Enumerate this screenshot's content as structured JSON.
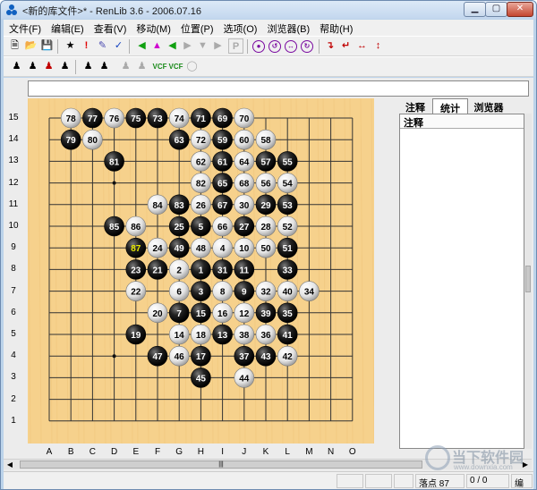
{
  "window": {
    "title": "<新的库文件>* - RenLib 3.6 - 2006.07.16",
    "minimize_label": "▁",
    "maximize_label": "▢",
    "close_label": "✕"
  },
  "menu": [
    "文件(F)",
    "编辑(E)",
    "查看(V)",
    "移动(M)",
    "位置(P)",
    "选项(O)",
    "浏览器(B)",
    "帮助(H)"
  ],
  "toolbar1": {
    "p_label": "P"
  },
  "toolbar2": {
    "vcf1_label": "VCF",
    "vcf2_label": "VCF"
  },
  "board": {
    "columns": [
      "A",
      "B",
      "C",
      "D",
      "E",
      "F",
      "G",
      "H",
      "I",
      "J",
      "K",
      "L",
      "M",
      "N",
      "O"
    ],
    "rows": [
      "15",
      "14",
      "13",
      "12",
      "11",
      "10",
      "9",
      "8",
      "7",
      "6",
      "5",
      "4",
      "3",
      "2",
      "1"
    ],
    "stones": [
      {
        "n": "1",
        "c": "H",
        "r": 8,
        "color": "black"
      },
      {
        "n": "2",
        "c": "G",
        "r": 8,
        "color": "white"
      },
      {
        "n": "3",
        "c": "H",
        "r": 7,
        "color": "black"
      },
      {
        "n": "4",
        "c": "I",
        "r": 9,
        "color": "white"
      },
      {
        "n": "5",
        "c": "H",
        "r": 10,
        "color": "black"
      },
      {
        "n": "6",
        "c": "G",
        "r": 7,
        "color": "white"
      },
      {
        "n": "7",
        "c": "G",
        "r": 6,
        "color": "black"
      },
      {
        "n": "8",
        "c": "I",
        "r": 7,
        "color": "white"
      },
      {
        "n": "9",
        "c": "J",
        "r": 7,
        "color": "black"
      },
      {
        "n": "10",
        "c": "J",
        "r": 9,
        "color": "white"
      },
      {
        "n": "11",
        "c": "J",
        "r": 8,
        "color": "black"
      },
      {
        "n": "12",
        "c": "J",
        "r": 6,
        "color": "white"
      },
      {
        "n": "13",
        "c": "I",
        "r": 5,
        "color": "black"
      },
      {
        "n": "14",
        "c": "G",
        "r": 5,
        "color": "white"
      },
      {
        "n": "15",
        "c": "H",
        "r": 6,
        "color": "black"
      },
      {
        "n": "16",
        "c": "I",
        "r": 6,
        "color": "white"
      },
      {
        "n": "17",
        "c": "H",
        "r": 4,
        "color": "black"
      },
      {
        "n": "18",
        "c": "H",
        "r": 5,
        "color": "white"
      },
      {
        "n": "19",
        "c": "E",
        "r": 5,
        "color": "black"
      },
      {
        "n": "20",
        "c": "F",
        "r": 6,
        "color": "white"
      },
      {
        "n": "21",
        "c": "F",
        "r": 8,
        "color": "black"
      },
      {
        "n": "22",
        "c": "E",
        "r": 7,
        "color": "white"
      },
      {
        "n": "23",
        "c": "E",
        "r": 8,
        "color": "black"
      },
      {
        "n": "24",
        "c": "F",
        "r": 9,
        "color": "white"
      },
      {
        "n": "25",
        "c": "G",
        "r": 10,
        "color": "black"
      },
      {
        "n": "26",
        "c": "H",
        "r": 11,
        "color": "white"
      },
      {
        "n": "27",
        "c": "J",
        "r": 10,
        "color": "black"
      },
      {
        "n": "28",
        "c": "K",
        "r": 10,
        "color": "white"
      },
      {
        "n": "29",
        "c": "K",
        "r": 11,
        "color": "black"
      },
      {
        "n": "30",
        "c": "J",
        "r": 11,
        "color": "white"
      },
      {
        "n": "31",
        "c": "I",
        "r": 8,
        "color": "black"
      },
      {
        "n": "32",
        "c": "K",
        "r": 7,
        "color": "white"
      },
      {
        "n": "33",
        "c": "L",
        "r": 8,
        "color": "black"
      },
      {
        "n": "34",
        "c": "M",
        "r": 7,
        "color": "white"
      },
      {
        "n": "35",
        "c": "L",
        "r": 6,
        "color": "black"
      },
      {
        "n": "36",
        "c": "K",
        "r": 5,
        "color": "white"
      },
      {
        "n": "37",
        "c": "J",
        "r": 4,
        "color": "black"
      },
      {
        "n": "38",
        "c": "J",
        "r": 5,
        "color": "white"
      },
      {
        "n": "39",
        "c": "K",
        "r": 6,
        "color": "black"
      },
      {
        "n": "40",
        "c": "L",
        "r": 7,
        "color": "white"
      },
      {
        "n": "41",
        "c": "L",
        "r": 5,
        "color": "black"
      },
      {
        "n": "42",
        "c": "L",
        "r": 4,
        "color": "white"
      },
      {
        "n": "43",
        "c": "K",
        "r": 4,
        "color": "black"
      },
      {
        "n": "44",
        "c": "J",
        "r": 3,
        "color": "white"
      },
      {
        "n": "45",
        "c": "H",
        "r": 3,
        "color": "black"
      },
      {
        "n": "46",
        "c": "G",
        "r": 4,
        "color": "white"
      },
      {
        "n": "47",
        "c": "F",
        "r": 4,
        "color": "black"
      },
      {
        "n": "48",
        "c": "H",
        "r": 9,
        "color": "white"
      },
      {
        "n": "49",
        "c": "G",
        "r": 9,
        "color": "black"
      },
      {
        "n": "50",
        "c": "K",
        "r": 9,
        "color": "white"
      },
      {
        "n": "51",
        "c": "L",
        "r": 9,
        "color": "black"
      },
      {
        "n": "52",
        "c": "L",
        "r": 10,
        "color": "white"
      },
      {
        "n": "53",
        "c": "L",
        "r": 11,
        "color": "black"
      },
      {
        "n": "54",
        "c": "L",
        "r": 12,
        "color": "white"
      },
      {
        "n": "55",
        "c": "L",
        "r": 13,
        "color": "black"
      },
      {
        "n": "56",
        "c": "K",
        "r": 12,
        "color": "white"
      },
      {
        "n": "57",
        "c": "K",
        "r": 13,
        "color": "black"
      },
      {
        "n": "58",
        "c": "K",
        "r": 14,
        "color": "white"
      },
      {
        "n": "59",
        "c": "I",
        "r": 14,
        "color": "black"
      },
      {
        "n": "60",
        "c": "J",
        "r": 14,
        "color": "white"
      },
      {
        "n": "61",
        "c": "I",
        "r": 13,
        "color": "black"
      },
      {
        "n": "62",
        "c": "H",
        "r": 13,
        "color": "white"
      },
      {
        "n": "63",
        "c": "G",
        "r": 14,
        "color": "black"
      },
      {
        "n": "64",
        "c": "J",
        "r": 13,
        "color": "white"
      },
      {
        "n": "65",
        "c": "I",
        "r": 12,
        "color": "black"
      },
      {
        "n": "66",
        "c": "I",
        "r": 10,
        "color": "white"
      },
      {
        "n": "67",
        "c": "I",
        "r": 11,
        "color": "black"
      },
      {
        "n": "68",
        "c": "J",
        "r": 12,
        "color": "white"
      },
      {
        "n": "69",
        "c": "I",
        "r": 15,
        "color": "black"
      },
      {
        "n": "70",
        "c": "J",
        "r": 15,
        "color": "white"
      },
      {
        "n": "71",
        "c": "H",
        "r": 15,
        "color": "black"
      },
      {
        "n": "72",
        "c": "H",
        "r": 14,
        "color": "white"
      },
      {
        "n": "73",
        "c": "F",
        "r": 15,
        "color": "black"
      },
      {
        "n": "74",
        "c": "G",
        "r": 15,
        "color": "white"
      },
      {
        "n": "75",
        "c": "E",
        "r": 15,
        "color": "black"
      },
      {
        "n": "76",
        "c": "D",
        "r": 15,
        "color": "white"
      },
      {
        "n": "77",
        "c": "C",
        "r": 15,
        "color": "black"
      },
      {
        "n": "78",
        "c": "B",
        "r": 15,
        "color": "white"
      },
      {
        "n": "79",
        "c": "B",
        "r": 14,
        "color": "black"
      },
      {
        "n": "80",
        "c": "C",
        "r": 14,
        "color": "white"
      },
      {
        "n": "81",
        "c": "D",
        "r": 13,
        "color": "black"
      },
      {
        "n": "82",
        "c": "H",
        "r": 12,
        "color": "white"
      },
      {
        "n": "83",
        "c": "G",
        "r": 11,
        "color": "black"
      },
      {
        "n": "84",
        "c": "F",
        "r": 11,
        "color": "white"
      },
      {
        "n": "85",
        "c": "D",
        "r": 10,
        "color": "black"
      },
      {
        "n": "86",
        "c": "E",
        "r": 10,
        "color": "white"
      },
      {
        "n": "87",
        "c": "E",
        "r": 9,
        "color": "black",
        "last": true
      }
    ],
    "star_points": [
      {
        "c": "D",
        "r": 12
      },
      {
        "c": "L",
        "r": 12
      },
      {
        "c": "H",
        "r": 8
      },
      {
        "c": "D",
        "r": 4
      },
      {
        "c": "L",
        "r": 4
      }
    ],
    "colors": {
      "board": "#f6d18c",
      "line": "#333333",
      "last_move_text": "#e8e800"
    }
  },
  "panel": {
    "tabs": [
      "注释",
      "统计",
      "浏览器"
    ],
    "header": "注释"
  },
  "status": {
    "step": "落点 87",
    "ratio": "0 / 0",
    "mode": "编"
  },
  "watermark": {
    "text": "当下软件园",
    "url": "www.downxia.com"
  }
}
